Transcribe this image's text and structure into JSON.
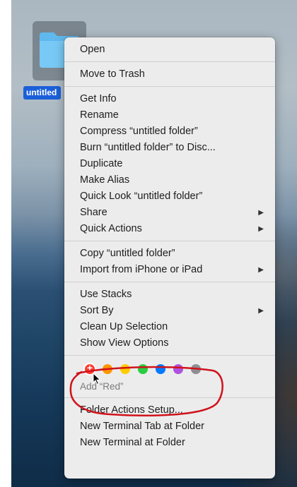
{
  "desktop": {
    "folder_label": "untitled"
  },
  "menu": {
    "groups": [
      [
        {
          "label": "Open"
        }
      ],
      [
        {
          "label": "Move to Trash"
        }
      ],
      [
        {
          "label": "Get Info"
        },
        {
          "label": "Rename"
        },
        {
          "label": "Compress “untitled folder”"
        },
        {
          "label": "Burn “untitled folder” to Disc..."
        },
        {
          "label": "Duplicate"
        },
        {
          "label": "Make Alias"
        },
        {
          "label": "Quick Look “untitled folder”"
        },
        {
          "label": "Share",
          "submenu": true
        },
        {
          "label": "Quick Actions",
          "submenu": true
        }
      ],
      [
        {
          "label": "Copy “untitled folder”"
        },
        {
          "label": "Import from iPhone or iPad",
          "submenu": true
        }
      ],
      [
        {
          "label": "Use Stacks"
        },
        {
          "label": "Sort By",
          "submenu": true
        },
        {
          "label": "Clean Up Selection"
        },
        {
          "label": "Show View Options"
        }
      ]
    ],
    "tags": {
      "colors": [
        {
          "name": "red",
          "hex": "#ff3b30"
        },
        {
          "name": "orange",
          "hex": "#ff9500"
        },
        {
          "name": "yellow",
          "hex": "#ffcc00"
        },
        {
          "name": "green",
          "hex": "#28cd41"
        },
        {
          "name": "blue",
          "hex": "#007aff"
        },
        {
          "name": "purple",
          "hex": "#af52de"
        },
        {
          "name": "gray",
          "hex": "#8e8e93"
        }
      ],
      "caption": "Add “Red”"
    },
    "footer_items": [
      {
        "label": "Folder Actions Setup..."
      },
      {
        "label": "New Terminal Tab at Folder"
      },
      {
        "label": "New Terminal at Folder"
      }
    ]
  },
  "annotation_color": "#d0121b"
}
